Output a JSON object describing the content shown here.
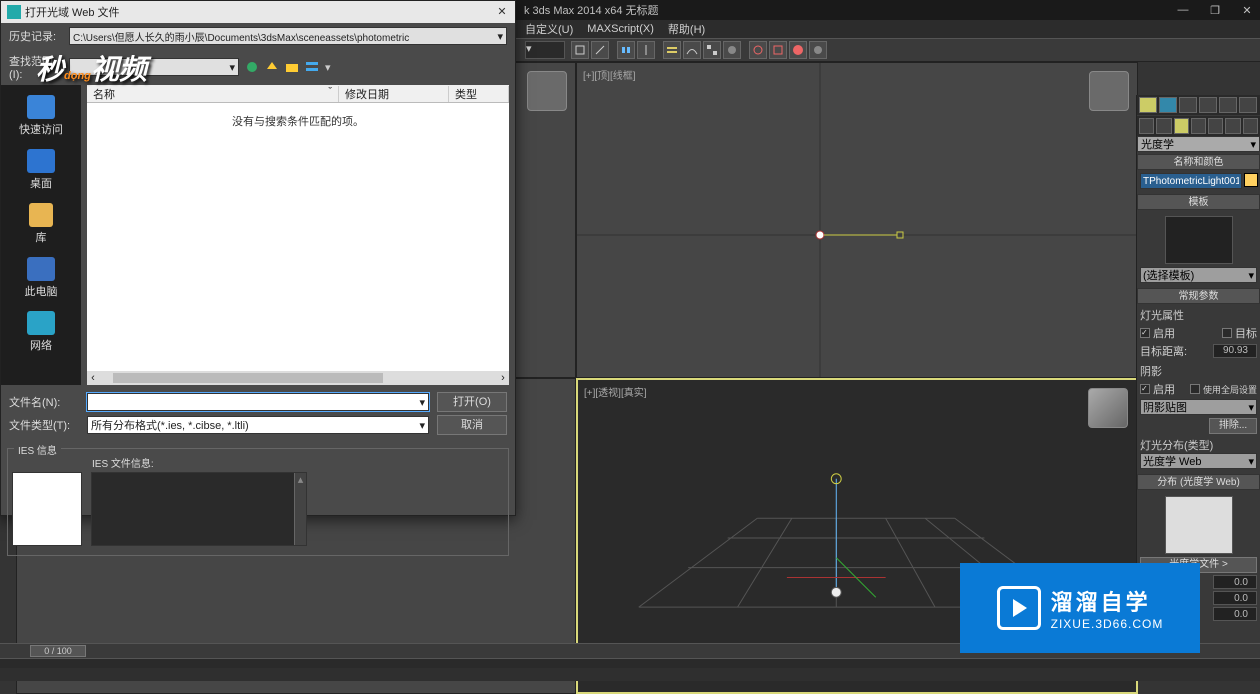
{
  "app": {
    "title": "k 3ds Max  2014 x64     无标题",
    "menu": {
      "customize": "自定义(U)",
      "maxscript": "MAXScript(X)",
      "help": "帮助(H)"
    },
    "win": {
      "min": "—",
      "max": "❐",
      "close": "✕"
    }
  },
  "viewports": {
    "top": "[+][顶][线框]",
    "persp": "[+][透视][真实]"
  },
  "dialog": {
    "title": "打开光域 Web 文件",
    "close": "✕",
    "history_label": "历史记录:",
    "history": "C:\\Users\\但愿人长久的雨小辰\\Documents\\3dsMax\\sceneassets\\photometric",
    "lookin_label": "查找范围(I):",
    "lookin": "",
    "places": {
      "quick": "快速访问",
      "desktop": "桌面",
      "lib": "库",
      "thispc": "此电脑",
      "network": "网络"
    },
    "cols": {
      "name": "名称",
      "date": "修改日期",
      "type": "类型"
    },
    "empty": "没有与搜索条件匹配的项。",
    "filename_label": "文件名(N):",
    "filename": "",
    "filetype_label": "文件类型(T):",
    "filetype": "所有分布格式(*.ies, *.cibse, *.ltli)",
    "open_btn": "打开(O)",
    "cancel_btn": "取消",
    "ies_group": "IES 信息",
    "ies_file_label": "IES 文件信息:"
  },
  "panel": {
    "category": "光度学",
    "r_name": "名称和颜色",
    "obj_name": "TPhotometricLight001",
    "r_template": "模板",
    "template_sel": "(选择模板)",
    "r_general": "常规参数",
    "lightprops": "灯光属性",
    "enable": "启用",
    "target": "目标",
    "targ_dist": "目标距离:",
    "targ_dist_val": "90.93",
    "shadow": "阴影",
    "use_global": "使用全局设置",
    "shadow_type": "阴影贴图",
    "exclude": "排除...",
    "dist_label": "灯光分布(类型)",
    "dist_type": "光度学 Web",
    "r_dist": "分布 (光度学 Web)",
    "webfile_btn": "光度学文件 >",
    "spin1": "0.0",
    "spin2": "0.0",
    "spin3": "0.0"
  },
  "timeline": {
    "pos": "0 / 100"
  },
  "logo_left": "秒dong视频",
  "logo_right": {
    "l1": "溜溜自学",
    "l2": "ZIXUE.3D66.COM"
  }
}
